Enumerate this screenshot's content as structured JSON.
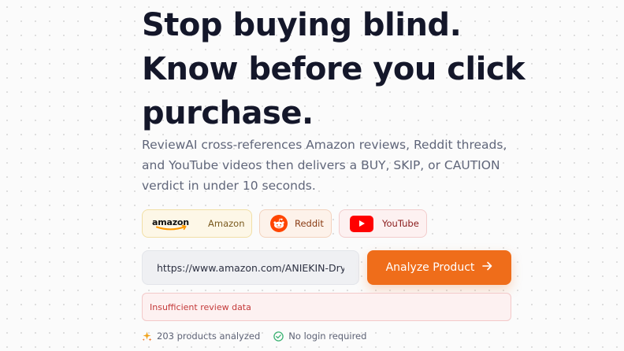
{
  "hero": {
    "headline_lines": [
      "Stop buying blind.",
      "Know before you click",
      "purchase."
    ],
    "subtitle_lines": [
      "ReviewAI cross-references Amazon reviews, Reddit threads,",
      "and YouTube videos then delivers a BUY, SKIP, or CAUTION",
      "verdict in under 10 seconds."
    ]
  },
  "sources": [
    {
      "id": "amazon",
      "logo_text": "amazon",
      "label": "Amazon",
      "icon": "amazon-logo-icon",
      "color": "#ff9900"
    },
    {
      "id": "reddit",
      "label": "Reddit",
      "icon": "reddit-icon",
      "color": "#ff4500"
    },
    {
      "id": "youtube",
      "label": "YouTube",
      "icon": "youtube-icon",
      "color": "#ff0000"
    }
  ],
  "search": {
    "value": "https://www.amazon.com/ANIEKIN-Drying"
  },
  "analyze_button": {
    "label": "Analyze Product",
    "icon": "arrow-right-icon",
    "color": "#ef6d1a"
  },
  "error": {
    "message": "Insufficient review data"
  },
  "footer": {
    "items": [
      {
        "text": "203 products analyzed",
        "icon": "sparkle-icon"
      },
      {
        "text": "No login required",
        "icon": "check-circle-icon"
      }
    ]
  }
}
